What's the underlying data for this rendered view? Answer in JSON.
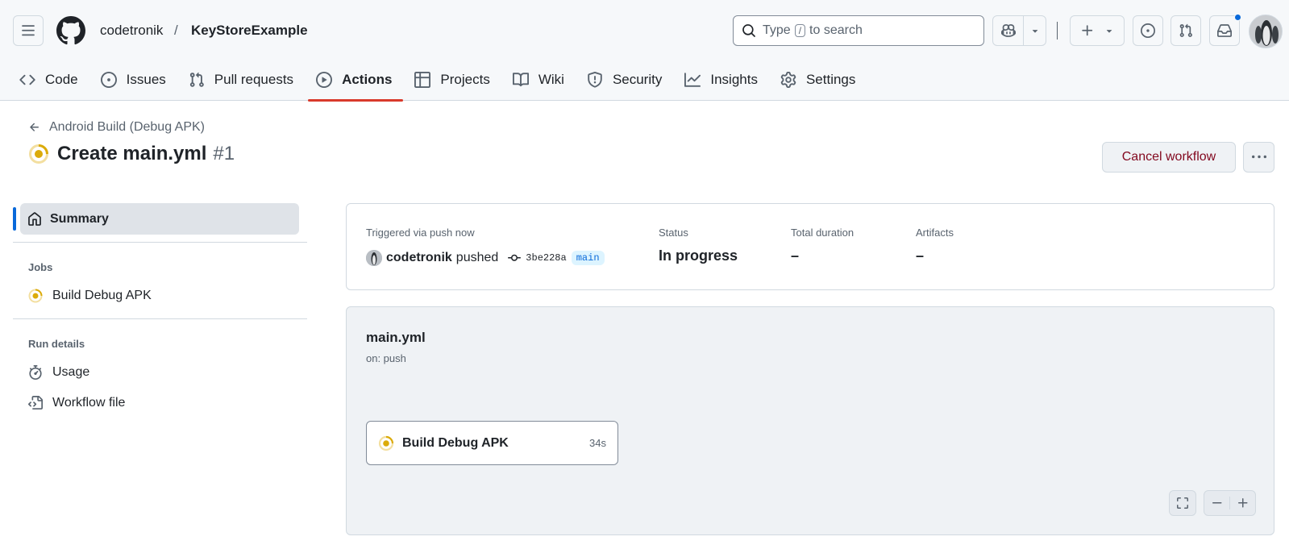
{
  "header": {
    "owner": "codetronik",
    "separator": "/",
    "repo": "KeyStoreExample",
    "search": {
      "prefix": "Type",
      "key": "/",
      "suffix": "to search"
    }
  },
  "tabs": [
    {
      "label": "Code",
      "icon": "code-icon"
    },
    {
      "label": "Issues",
      "icon": "issue-icon"
    },
    {
      "label": "Pull requests",
      "icon": "pull-request-icon"
    },
    {
      "label": "Actions",
      "icon": "play-icon",
      "active": true
    },
    {
      "label": "Projects",
      "icon": "table-icon"
    },
    {
      "label": "Wiki",
      "icon": "book-icon"
    },
    {
      "label": "Security",
      "icon": "shield-icon"
    },
    {
      "label": "Insights",
      "icon": "graph-icon"
    },
    {
      "label": "Settings",
      "icon": "gear-icon"
    }
  ],
  "run": {
    "back_label": "Android Build (Debug APK)",
    "title": "Create main.yml",
    "number": "#1",
    "cancel_label": "Cancel workflow"
  },
  "sidebar": {
    "summary_label": "Summary",
    "jobs_heading": "Jobs",
    "jobs": [
      {
        "label": "Build Debug APK",
        "status": "in_progress"
      }
    ],
    "run_details_heading": "Run details",
    "details": [
      {
        "label": "Usage",
        "icon": "stopwatch-icon"
      },
      {
        "label": "Workflow file",
        "icon": "file-code-icon"
      }
    ]
  },
  "summary": {
    "trigger_label": "Triggered via push now",
    "actor": "codetronik",
    "action": "pushed",
    "sha": "3be228a",
    "branch": "main",
    "status_label": "Status",
    "status_value": "In progress",
    "duration_label": "Total duration",
    "duration_value": "–",
    "artifacts_label": "Artifacts",
    "artifacts_value": "–"
  },
  "graph": {
    "file": "main.yml",
    "trigger": "on: push",
    "job_name": "Build Debug APK",
    "job_duration": "34s"
  },
  "colors": {
    "accent_active_tab": "#d93a2b",
    "in_progress": "#dbab0a",
    "danger_text": "#82071e",
    "link_blue": "#0969da"
  }
}
